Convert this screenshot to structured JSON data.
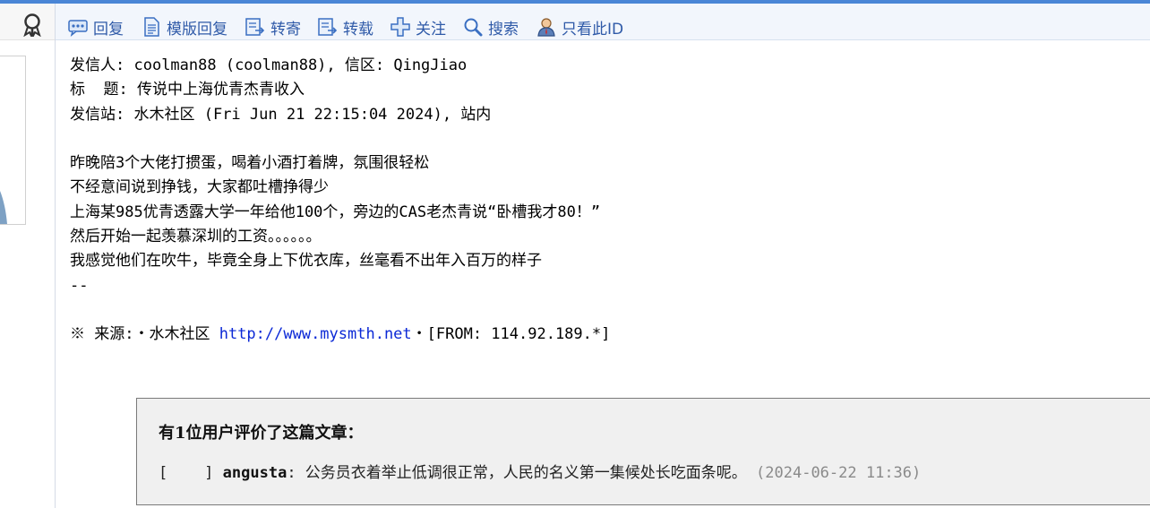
{
  "toolbar": {
    "items": [
      {
        "label": "回复",
        "icon": "reply-icon"
      },
      {
        "label": "模版回复",
        "icon": "template-reply-icon"
      },
      {
        "label": "转寄",
        "icon": "forward-icon"
      },
      {
        "label": "转载",
        "icon": "repost-icon"
      },
      {
        "label": "关注",
        "icon": "follow-icon"
      },
      {
        "label": "搜索",
        "icon": "search-icon"
      },
      {
        "label": "只看此ID",
        "icon": "user-filter-icon"
      }
    ]
  },
  "post": {
    "sender_label": "发信人: ",
    "sender": "coolman88 (coolman88), 信区: QingJiao",
    "title_label": "标  题: ",
    "title": "传说中上海优青杰青收入",
    "site_label": "发信站: ",
    "site": "水木社区 (Fri Jun 21 22:15:04 2024), 站内",
    "body": [
      "昨晚陪3个大佬打掼蛋，喝着小酒打着牌，氛围很轻松",
      "不经意间说到挣钱，大家都吐槽挣得少",
      "上海某985优青透露大学一年给他100个，旁边的CAS老杰青说“卧槽我才80！”",
      "然后开始一起羡慕深圳的工资。。。。。。",
      "我感觉他们在吹牛，毕竟全身上下优衣库，丝毫看不出年入百万的样子"
    ],
    "sig_sep": "--",
    "source_prefix": "※ 来源:・水木社区 ",
    "source_link": "http://www.mysmth.net",
    "source_suffix": "・[FROM: 114.92.189.*]"
  },
  "reviews": {
    "title": "有1位用户评价了这篇文章：",
    "items": [
      {
        "bracket": "[    ] ",
        "user": "angusta",
        "colon": ": ",
        "text": "公务员衣着举止低调很正常，人民的名义第一集候处长吃面条呢。",
        "time": " (2024-06-22 11:36)"
      }
    ]
  }
}
